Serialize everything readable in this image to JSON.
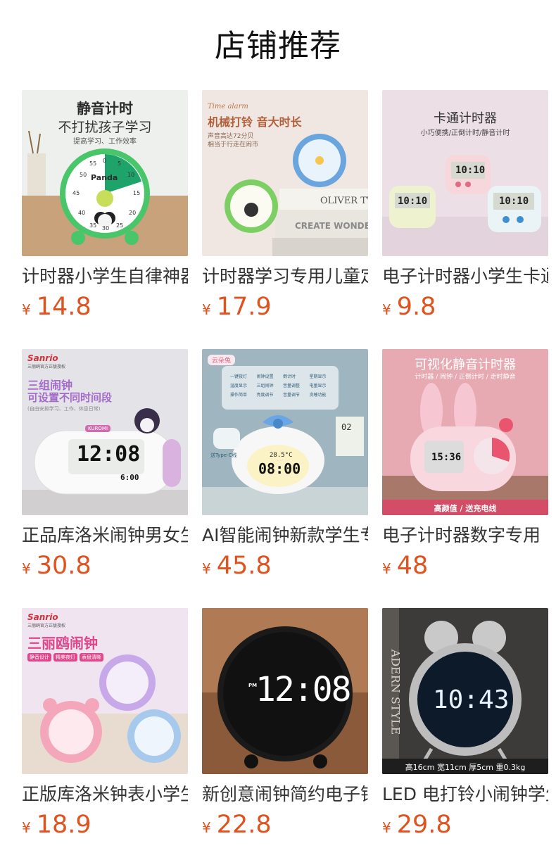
{
  "section": {
    "title": "店铺推荐"
  },
  "products": [
    {
      "name": "计时器小学生自律神器",
      "currency": "¥",
      "price": "14.8",
      "image": {
        "headline": "静音计时",
        "subline": "不打扰孩子学习",
        "tag": "提高学习、工作效率",
        "brand": "Panda",
        "dial": [
          "55",
          "0",
          "5",
          "50",
          "10",
          "45",
          "15",
          "40",
          "20",
          "35",
          "30",
          "25"
        ]
      }
    },
    {
      "name": "计时器学习专用儿童定时器",
      "currency": "¥",
      "price": "17.9",
      "image": {
        "tagline": "Time alarm",
        "headline": "机械打铃 音大时长",
        "note1": "声音高达72分贝",
        "note2": "相当于行走在闹市",
        "book1": "OLIVER TW",
        "book2": "CREATE WONDERFU"
      }
    },
    {
      "name": "电子计时器小学生卡通",
      "currency": "¥",
      "price": "9.8",
      "image": {
        "headline": "卡通计时器",
        "subline": "小巧便携/正倒计时/静音计时",
        "display": "10:10"
      }
    },
    {
      "name": "正品库洛米闹钟男女生",
      "currency": "¥",
      "price": "30.8",
      "image": {
        "brand": "Sanrio",
        "brand_sub": "三丽鸥官方正版授权",
        "headline1": "三组闹钟",
        "headline2": "可设置不同时间段",
        "note": "(自由安排学习、工作、休息日常)",
        "badge": "KUROMI",
        "display": "12:08",
        "sub_display": "6:00"
      }
    },
    {
      "name": "AI智能闹钟新款学生专用",
      "currency": "¥",
      "price": "45.8",
      "image": {
        "brand": "云朵兔",
        "features": [
          "一键夜灯",
          "闹钟设置",
          "倒计时",
          "星期显示",
          "温度显示",
          "三组闹钟",
          "音量调整",
          "电量显示",
          "操作简单",
          "亮度调节",
          "音量调节",
          "贪睡功能"
        ],
        "cable": "送Type-C线",
        "temp": "28.5°C",
        "display": "08:00",
        "date": "02"
      }
    },
    {
      "name": "电子计时器数字专用",
      "currency": "¥",
      "price": "48",
      "image": {
        "headline": "可视化静音计时器",
        "subline": "计时器 / 闹钟 / 正倒计时 / 走时静音",
        "display": "15:36",
        "banner": "高颜值 / 送充电线"
      }
    },
    {
      "name": "正版库洛米钟表小学生",
      "currency": "¥",
      "price": "18.9",
      "image": {
        "brand": "Sanrio",
        "brand_sub": "三丽鸥官方正版授权",
        "headline": "三丽鸥闹钟",
        "chips": [
          "静音设计",
          "精美夜灯",
          "表盘清晰"
        ]
      }
    },
    {
      "name": "新创意闹钟简约电子钟",
      "currency": "¥",
      "price": "22.8",
      "image": {
        "pm": "PM",
        "display": "12:08"
      }
    },
    {
      "name": "LED 电打铃小闹钟学生",
      "currency": "¥",
      "price": "29.8",
      "image": {
        "backdrop": "ADERN STYLE",
        "display": "10:43",
        "spec": "高16cm 宽11cm 厚5cm 重0.3kg"
      }
    }
  ]
}
